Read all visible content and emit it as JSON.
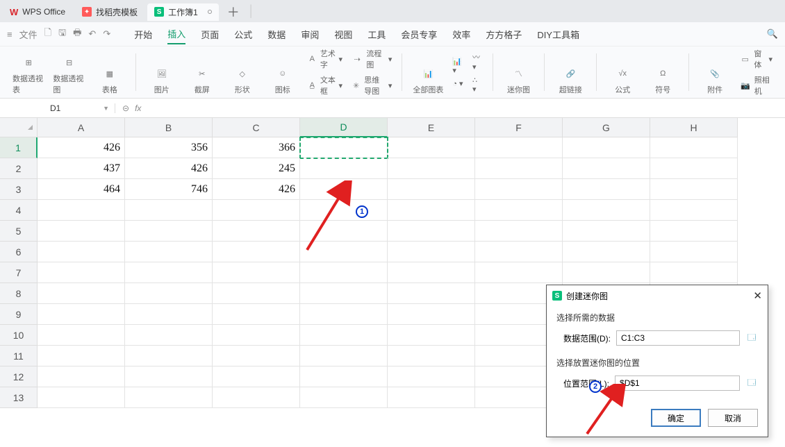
{
  "tabs": {
    "wps": "WPS Office",
    "template": "找稻壳模板",
    "workbook": "工作簿1"
  },
  "file_menu_label": "文件",
  "menu": {
    "start": "开始",
    "insert": "插入",
    "page": "页面",
    "formula": "公式",
    "data": "数据",
    "review": "审阅",
    "view": "视图",
    "tools": "工具",
    "member": "会员专享",
    "efficiency": "效率",
    "fang": "方方格子",
    "diy": "DIY工具箱"
  },
  "ribbon": {
    "pivot_table": "数据透视表",
    "pivot_chart": "数据透视图",
    "table": "表格",
    "picture": "图片",
    "screenshot": "截屏",
    "shapes": "形状",
    "icons": "图标",
    "wordart": "艺术字",
    "textbox": "文本框",
    "flowchart": "流程图",
    "mindmap": "思维导图",
    "all_charts": "全部图表",
    "sparkline": "迷你图",
    "hyperlink": "超链接",
    "formula_btn": "公式",
    "symbol": "符号",
    "attachment": "附件",
    "window": "窗体",
    "camera": "照相机"
  },
  "name_box": "D1",
  "fx_label": "fx",
  "columns": [
    "A",
    "B",
    "C",
    "D",
    "E",
    "F",
    "G",
    "H"
  ],
  "rows_label_count": 13,
  "data_cells": {
    "r1": {
      "A": "426",
      "B": "356",
      "C": "366"
    },
    "r2": {
      "A": "437",
      "B": "426",
      "C": "245"
    },
    "r3": {
      "A": "464",
      "B": "746",
      "C": "426"
    }
  },
  "dialog": {
    "title": "创建迷你图",
    "section1": "选择所需的数据",
    "data_range_label": "数据范围(D):",
    "data_range_value": "C1:C3",
    "section2": "选择放置迷你图的位置",
    "location_label": "位置范围(L):",
    "location_value": "$D$1",
    "ok": "确定",
    "cancel": "取消"
  },
  "badges": {
    "one": "1",
    "two": "2"
  }
}
